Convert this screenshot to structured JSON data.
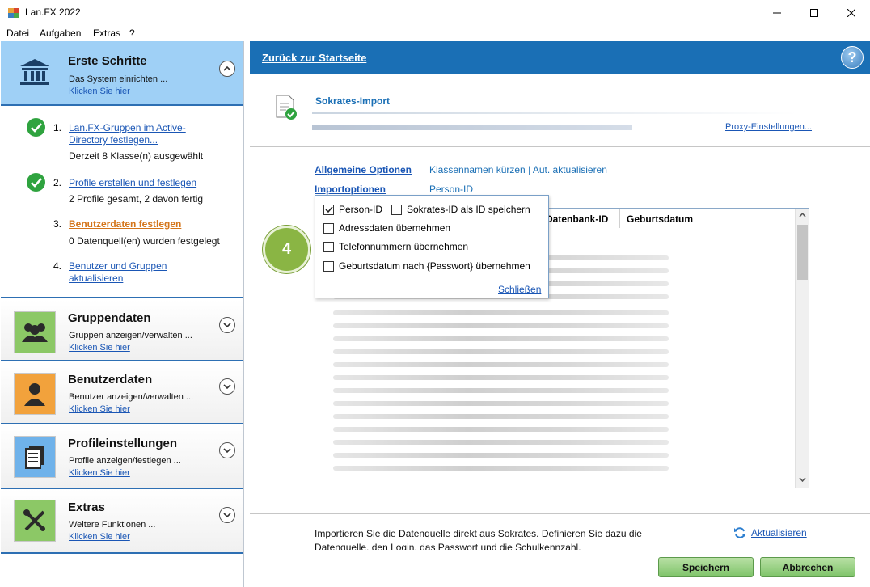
{
  "window": {
    "title": "Lan.FX 2022"
  },
  "menu": [
    "Datei",
    "Aufgaben",
    "Extras",
    "?"
  ],
  "sidebar": {
    "active": {
      "title": "Erste Schritte",
      "subtitle": "Das System einrichten ...",
      "link": "Klicken Sie hier"
    },
    "steps": [
      {
        "num": "1.",
        "link": "Lan.FX-Gruppen im Active-Directory festlegen...",
        "info": "Derzeit 8 Klasse(n) ausgewählt",
        "done": true
      },
      {
        "num": "2.",
        "link": "Profile erstellen und festlegen",
        "info": "2 Profile gesamt, 2 davon fertig",
        "done": true
      },
      {
        "num": "3.",
        "link": "Benutzerdaten festlegen",
        "info": "0 Datenquell(en) wurden festgelegt",
        "done": false
      },
      {
        "num": "4.",
        "link": "Benutzer und Gruppen aktualisieren",
        "info": "",
        "done": false
      }
    ],
    "sections": [
      {
        "title": "Gruppendaten",
        "subtitle": "Gruppen anzeigen/verwalten ...",
        "link": "Klicken Sie hier",
        "icon": "group-icon",
        "color": "#8cc866"
      },
      {
        "title": "Benutzerdaten",
        "subtitle": "Benutzer anzeigen/verwalten ...",
        "link": "Klicken Sie hier",
        "icon": "user-icon",
        "color": "#f2a23c"
      },
      {
        "title": "Profileinstellungen",
        "subtitle": "Profile anzeigen/festlegen ...",
        "link": "Klicken Sie hier",
        "icon": "document-icon",
        "color": "#6fb2ea"
      },
      {
        "title": "Extras",
        "subtitle": "Weitere Funktionen ...",
        "link": "Klicken Sie hier",
        "icon": "tools-icon",
        "color": "#8cc866"
      }
    ]
  },
  "main": {
    "back_link": "Zurück zur Startseite",
    "help": "?",
    "import_title": "Sokrates-Import",
    "proxy_link": "Proxy-Einstellungen...",
    "options": [
      {
        "label": "Allgemeine Optionen",
        "value": "Klassennamen kürzen | Aut. aktualisieren"
      },
      {
        "label": "Importoptionen",
        "value": "Person-ID"
      }
    ],
    "table_columns": [
      "Datenbank-ID",
      "Geburtsdatum"
    ],
    "popup": {
      "items": [
        {
          "label": "Person-ID",
          "checked": true
        },
        {
          "label": "Sokrates-ID als ID speichern",
          "checked": false
        },
        {
          "label": "Adressdaten übernehmen",
          "checked": false
        },
        {
          "label": "Telefonnummern übernehmen",
          "checked": false
        },
        {
          "label": "Geburtsdatum nach {Passwort} übernehmen",
          "checked": false
        }
      ],
      "close": "Schließen"
    },
    "badge": "4",
    "bottom_text": "Importieren Sie die Datenquelle direkt aus Sokrates. Definieren Sie dazu die Datenquelle, den Login, das Passwort und die Schulkennzahl.",
    "refresh": "Aktualisieren",
    "save": "Speichern",
    "cancel": "Abbrechen"
  }
}
